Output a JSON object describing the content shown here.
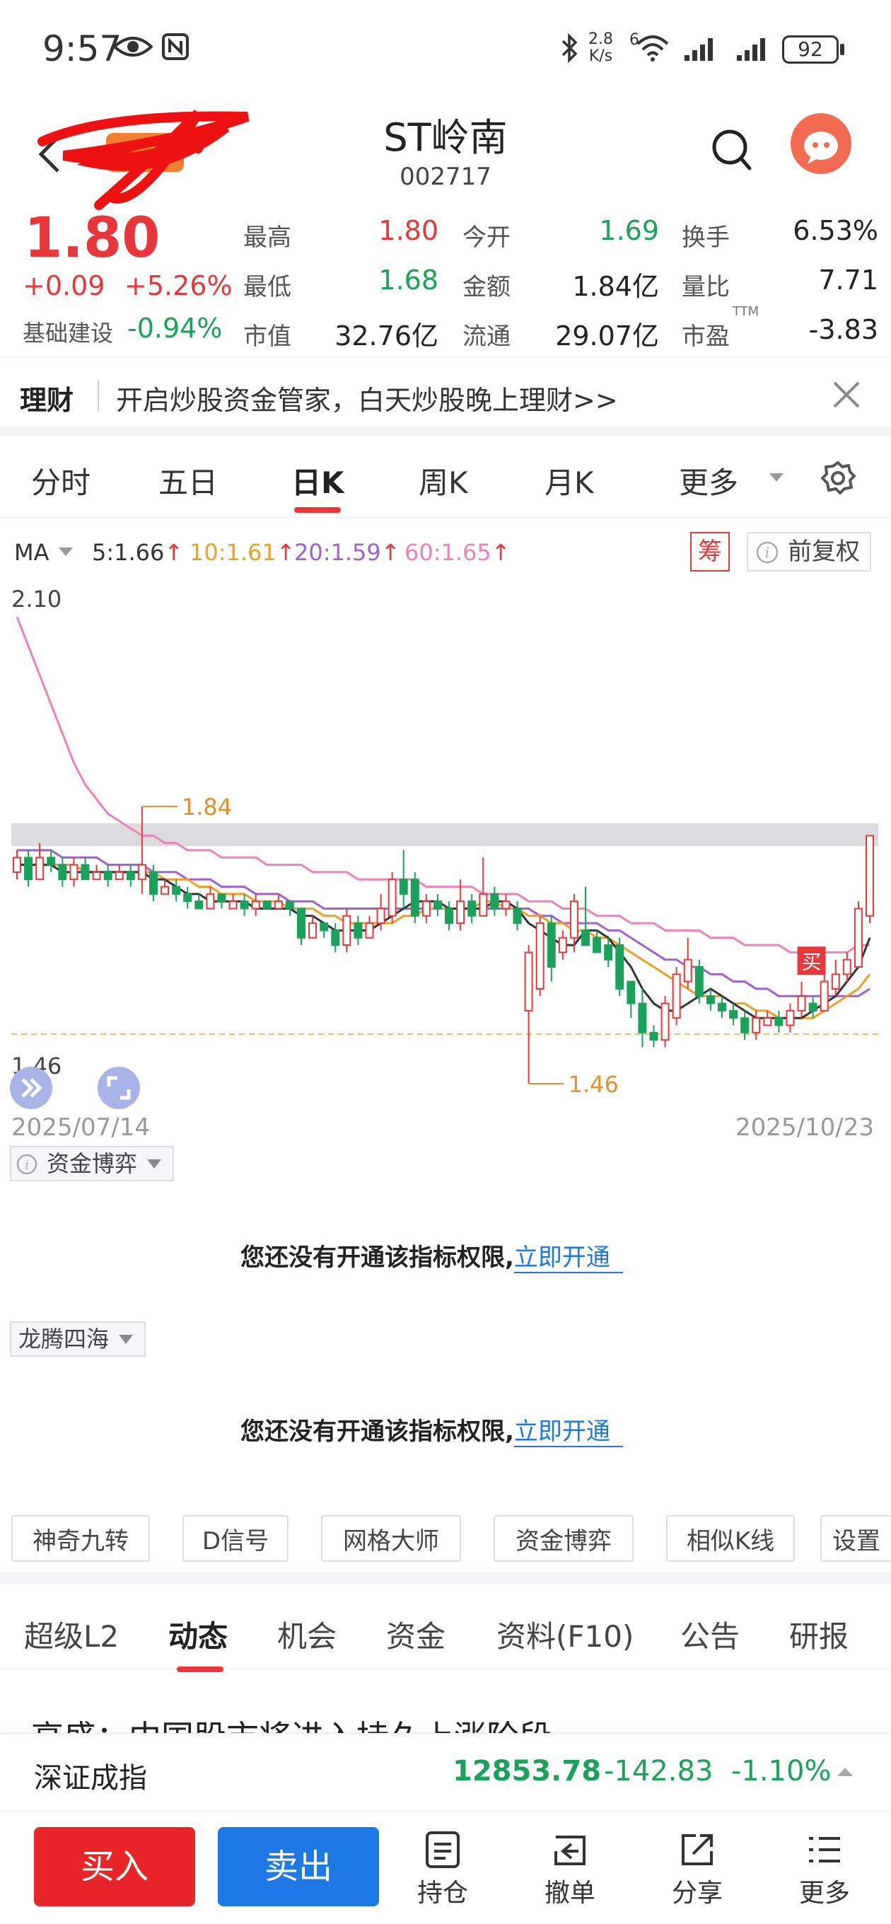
{
  "status": {
    "time": "9:57",
    "net_speed_top": "2.8",
    "net_speed_unit": "K/s",
    "net_type": "6",
    "battery": "92"
  },
  "header": {
    "stock_name": "ST岭南",
    "stock_code": "002717"
  },
  "quote": {
    "price": "1.80",
    "change": "+0.09",
    "change_pct": "+5.26%",
    "sector_name": "基础建设",
    "sector_pct": "-0.94%",
    "high_label": "最高",
    "high_value": "1.80",
    "low_label": "最低",
    "low_value": "1.68",
    "mcap_label": "市值",
    "mcap_value": "32.76亿",
    "open_label": "今开",
    "open_value": "1.69",
    "amount_label": "金额",
    "amount_value": "1.84亿",
    "float_label": "流通",
    "float_value": "29.07亿",
    "turnover_label": "换手",
    "turnover_value": "6.53%",
    "volratio_label": "量比",
    "volratio_value": "7.71",
    "pe_label": "市盈",
    "pe_sup": "TTM",
    "pe_value": "-3.83"
  },
  "promo": {
    "tag": "理财",
    "text": "开启炒股资金管家，白天炒股晚上理财>>"
  },
  "chart_tabs": {
    "items": [
      "分时",
      "五日",
      "日K",
      "周K",
      "月K"
    ],
    "more": "更多",
    "active_index": 2
  },
  "ma_legend": {
    "ma": "MA",
    "ma5": "5:1.66",
    "ma10": "10:1.61",
    "ma20": "20:1.59",
    "ma60": "60:1.65",
    "chip_btn": "筹",
    "adjust_btn": "前复权",
    "colors": {
      "ma5": "#333333",
      "ma10": "#f0a020",
      "ma20": "#a060d0",
      "ma60": "#f080b8"
    }
  },
  "chart_data": {
    "type": "candlestick",
    "y_top_label": "2.10",
    "y_bottom_label": "1.46",
    "ylim": [
      1.46,
      2.1
    ],
    "x_start": "2025/07/14",
    "x_end": "2025/10/23",
    "high_annotation": "1.84",
    "low_annotation": "1.46",
    "buy_marker": "买",
    "up_color": "#e8373a",
    "down_color": "#1aa25a",
    "candles": [
      {
        "o": 1.75,
        "c": 1.77,
        "h": 1.78,
        "l": 1.74
      },
      {
        "o": 1.77,
        "c": 1.74,
        "h": 1.78,
        "l": 1.73
      },
      {
        "o": 1.74,
        "c": 1.77,
        "h": 1.79,
        "l": 1.74
      },
      {
        "o": 1.77,
        "c": 1.76,
        "h": 1.78,
        "l": 1.75
      },
      {
        "o": 1.76,
        "c": 1.74,
        "h": 1.77,
        "l": 1.73
      },
      {
        "o": 1.74,
        "c": 1.76,
        "h": 1.77,
        "l": 1.73
      },
      {
        "o": 1.76,
        "c": 1.74,
        "h": 1.77,
        "l": 1.74
      },
      {
        "o": 1.74,
        "c": 1.75,
        "h": 1.76,
        "l": 1.74
      },
      {
        "o": 1.75,
        "c": 1.74,
        "h": 1.76,
        "l": 1.73
      },
      {
        "o": 1.74,
        "c": 1.75,
        "h": 1.76,
        "l": 1.74
      },
      {
        "o": 1.75,
        "c": 1.74,
        "h": 1.76,
        "l": 1.73
      },
      {
        "o": 1.74,
        "c": 1.76,
        "h": 1.84,
        "l": 1.72
      },
      {
        "o": 1.75,
        "c": 1.72,
        "h": 1.76,
        "l": 1.71
      },
      {
        "o": 1.72,
        "c": 1.73,
        "h": 1.74,
        "l": 1.72
      },
      {
        "o": 1.73,
        "c": 1.72,
        "h": 1.74,
        "l": 1.71
      },
      {
        "o": 1.72,
        "c": 1.71,
        "h": 1.73,
        "l": 1.7
      },
      {
        "o": 1.71,
        "c": 1.7,
        "h": 1.72,
        "l": 1.7
      },
      {
        "o": 1.7,
        "c": 1.72,
        "h": 1.73,
        "l": 1.7
      },
      {
        "o": 1.72,
        "c": 1.71,
        "h": 1.72,
        "l": 1.7
      },
      {
        "o": 1.7,
        "c": 1.71,
        "h": 1.72,
        "l": 1.7
      },
      {
        "o": 1.71,
        "c": 1.7,
        "h": 1.72,
        "l": 1.69
      },
      {
        "o": 1.7,
        "c": 1.71,
        "h": 1.72,
        "l": 1.69
      },
      {
        "o": 1.71,
        "c": 1.7,
        "h": 1.71,
        "l": 1.7
      },
      {
        "o": 1.7,
        "c": 1.71,
        "h": 1.72,
        "l": 1.7
      },
      {
        "o": 1.71,
        "c": 1.7,
        "h": 1.71,
        "l": 1.69
      },
      {
        "o": 1.7,
        "c": 1.66,
        "h": 1.7,
        "l": 1.65
      },
      {
        "o": 1.66,
        "c": 1.68,
        "h": 1.69,
        "l": 1.66
      },
      {
        "o": 1.68,
        "c": 1.67,
        "h": 1.68,
        "l": 1.66
      },
      {
        "o": 1.67,
        "c": 1.65,
        "h": 1.68,
        "l": 1.64
      },
      {
        "o": 1.65,
        "c": 1.69,
        "h": 1.7,
        "l": 1.64
      },
      {
        "o": 1.68,
        "c": 1.66,
        "h": 1.69,
        "l": 1.65
      },
      {
        "o": 1.66,
        "c": 1.68,
        "h": 1.69,
        "l": 1.66
      },
      {
        "o": 1.68,
        "c": 1.7,
        "h": 1.72,
        "l": 1.67
      },
      {
        "o": 1.69,
        "c": 1.74,
        "h": 1.75,
        "l": 1.68
      },
      {
        "o": 1.74,
        "c": 1.72,
        "h": 1.78,
        "l": 1.7
      },
      {
        "o": 1.74,
        "c": 1.69,
        "h": 1.75,
        "l": 1.68
      },
      {
        "o": 1.69,
        "c": 1.71,
        "h": 1.72,
        "l": 1.68
      },
      {
        "o": 1.71,
        "c": 1.7,
        "h": 1.72,
        "l": 1.69
      },
      {
        "o": 1.7,
        "c": 1.68,
        "h": 1.71,
        "l": 1.67
      },
      {
        "o": 1.68,
        "c": 1.71,
        "h": 1.74,
        "l": 1.67
      },
      {
        "o": 1.71,
        "c": 1.69,
        "h": 1.72,
        "l": 1.68
      },
      {
        "o": 1.69,
        "c": 1.72,
        "h": 1.77,
        "l": 1.69
      },
      {
        "o": 1.72,
        "c": 1.7,
        "h": 1.73,
        "l": 1.69
      },
      {
        "o": 1.7,
        "c": 1.71,
        "h": 1.72,
        "l": 1.69
      },
      {
        "o": 1.7,
        "c": 1.68,
        "h": 1.71,
        "l": 1.67
      },
      {
        "o": 1.56,
        "c": 1.64,
        "h": 1.65,
        "l": 1.46
      },
      {
        "o": 1.59,
        "c": 1.68,
        "h": 1.69,
        "l": 1.58
      },
      {
        "o": 1.68,
        "c": 1.62,
        "h": 1.69,
        "l": 1.6
      },
      {
        "o": 1.64,
        "c": 1.66,
        "h": 1.67,
        "l": 1.63
      },
      {
        "o": 1.66,
        "c": 1.71,
        "h": 1.72,
        "l": 1.64
      },
      {
        "o": 1.67,
        "c": 1.65,
        "h": 1.73,
        "l": 1.65
      },
      {
        "o": 1.66,
        "c": 1.64,
        "h": 1.67,
        "l": 1.64
      },
      {
        "o": 1.65,
        "c": 1.63,
        "h": 1.66,
        "l": 1.62
      },
      {
        "o": 1.65,
        "c": 1.59,
        "h": 1.66,
        "l": 1.58
      },
      {
        "o": 1.6,
        "c": 1.57,
        "h": 1.6,
        "l": 1.55
      },
      {
        "o": 1.57,
        "c": 1.53,
        "h": 1.59,
        "l": 1.51
      },
      {
        "o": 1.53,
        "c": 1.52,
        "h": 1.54,
        "l": 1.51
      },
      {
        "o": 1.52,
        "c": 1.57,
        "h": 1.58,
        "l": 1.51
      },
      {
        "o": 1.55,
        "c": 1.61,
        "h": 1.62,
        "l": 1.54
      },
      {
        "o": 1.6,
        "c": 1.63,
        "h": 1.66,
        "l": 1.59
      },
      {
        "o": 1.62,
        "c": 1.58,
        "h": 1.63,
        "l": 1.57
      },
      {
        "o": 1.58,
        "c": 1.57,
        "h": 1.59,
        "l": 1.56
      },
      {
        "o": 1.57,
        "c": 1.56,
        "h": 1.58,
        "l": 1.55
      },
      {
        "o": 1.56,
        "c": 1.55,
        "h": 1.57,
        "l": 1.54
      },
      {
        "o": 1.55,
        "c": 1.53,
        "h": 1.56,
        "l": 1.52
      },
      {
        "o": 1.53,
        "c": 1.55,
        "h": 1.56,
        "l": 1.52
      },
      {
        "o": 1.54,
        "c": 1.55,
        "h": 1.56,
        "l": 1.54
      },
      {
        "o": 1.55,
        "c": 1.54,
        "h": 1.56,
        "l": 1.53
      },
      {
        "o": 1.54,
        "c": 1.56,
        "h": 1.57,
        "l": 1.53
      },
      {
        "o": 1.56,
        "c": 1.58,
        "h": 1.6,
        "l": 1.55
      },
      {
        "o": 1.57,
        "c": 1.56,
        "h": 1.58,
        "l": 1.55
      },
      {
        "o": 1.56,
        "c": 1.6,
        "h": 1.61,
        "l": 1.56
      },
      {
        "o": 1.59,
        "c": 1.61,
        "h": 1.63,
        "l": 1.58
      },
      {
        "o": 1.61,
        "c": 1.63,
        "h": 1.64,
        "l": 1.6
      },
      {
        "o": 1.62,
        "c": 1.7,
        "h": 1.71,
        "l": 1.62
      },
      {
        "o": 1.69,
        "c": 1.8,
        "h": 1.8,
        "l": 1.68
      }
    ],
    "ma5": [
      1.76,
      1.76,
      1.76,
      1.76,
      1.75,
      1.75,
      1.75,
      1.75,
      1.75,
      1.75,
      1.75,
      1.75,
      1.74,
      1.74,
      1.73,
      1.72,
      1.72,
      1.71,
      1.71,
      1.71,
      1.71,
      1.7,
      1.7,
      1.7,
      1.7,
      1.69,
      1.69,
      1.68,
      1.67,
      1.67,
      1.67,
      1.67,
      1.68,
      1.69,
      1.7,
      1.71,
      1.71,
      1.71,
      1.7,
      1.7,
      1.7,
      1.7,
      1.71,
      1.71,
      1.7,
      1.68,
      1.67,
      1.66,
      1.65,
      1.65,
      1.67,
      1.67,
      1.66,
      1.64,
      1.62,
      1.59,
      1.57,
      1.56,
      1.56,
      1.57,
      1.58,
      1.59,
      1.58,
      1.57,
      1.56,
      1.55,
      1.55,
      1.55,
      1.55,
      1.55,
      1.56,
      1.57,
      1.58,
      1.6,
      1.62,
      1.66
    ],
    "ma10": [
      1.76,
      1.76,
      1.76,
      1.76,
      1.76,
      1.76,
      1.75,
      1.75,
      1.75,
      1.75,
      1.75,
      1.75,
      1.75,
      1.74,
      1.74,
      1.74,
      1.73,
      1.73,
      1.72,
      1.72,
      1.72,
      1.71,
      1.71,
      1.71,
      1.7,
      1.7,
      1.7,
      1.69,
      1.69,
      1.68,
      1.68,
      1.68,
      1.68,
      1.68,
      1.69,
      1.69,
      1.7,
      1.7,
      1.7,
      1.7,
      1.7,
      1.71,
      1.71,
      1.7,
      1.7,
      1.69,
      1.69,
      1.68,
      1.68,
      1.67,
      1.67,
      1.66,
      1.66,
      1.65,
      1.64,
      1.63,
      1.62,
      1.61,
      1.6,
      1.59,
      1.58,
      1.58,
      1.58,
      1.57,
      1.57,
      1.56,
      1.56,
      1.55,
      1.55,
      1.55,
      1.55,
      1.56,
      1.57,
      1.58,
      1.59,
      1.61
    ],
    "ma20": [
      1.78,
      1.78,
      1.78,
      1.78,
      1.77,
      1.77,
      1.77,
      1.77,
      1.76,
      1.76,
      1.76,
      1.76,
      1.75,
      1.75,
      1.75,
      1.74,
      1.74,
      1.74,
      1.73,
      1.73,
      1.73,
      1.72,
      1.72,
      1.72,
      1.71,
      1.71,
      1.71,
      1.7,
      1.7,
      1.7,
      1.7,
      1.7,
      1.7,
      1.7,
      1.7,
      1.7,
      1.7,
      1.7,
      1.7,
      1.7,
      1.7,
      1.7,
      1.7,
      1.7,
      1.7,
      1.7,
      1.69,
      1.69,
      1.68,
      1.68,
      1.68,
      1.68,
      1.67,
      1.67,
      1.66,
      1.65,
      1.64,
      1.63,
      1.63,
      1.62,
      1.62,
      1.61,
      1.61,
      1.6,
      1.6,
      1.59,
      1.59,
      1.58,
      1.58,
      1.58,
      1.58,
      1.58,
      1.58,
      1.58,
      1.58,
      1.59
    ],
    "ma60": [
      2.1,
      2.06,
      2.02,
      1.98,
      1.94,
      1.9,
      1.87,
      1.85,
      1.83,
      1.82,
      1.81,
      1.8,
      1.8,
      1.79,
      1.79,
      1.78,
      1.78,
      1.78,
      1.77,
      1.77,
      1.77,
      1.77,
      1.76,
      1.76,
      1.76,
      1.76,
      1.75,
      1.75,
      1.75,
      1.75,
      1.74,
      1.74,
      1.74,
      1.74,
      1.74,
      1.74,
      1.73,
      1.73,
      1.73,
      1.73,
      1.73,
      1.72,
      1.72,
      1.72,
      1.72,
      1.71,
      1.71,
      1.71,
      1.7,
      1.7,
      1.7,
      1.69,
      1.69,
      1.69,
      1.68,
      1.68,
      1.68,
      1.67,
      1.67,
      1.67,
      1.67,
      1.66,
      1.66,
      1.66,
      1.65,
      1.65,
      1.65,
      1.65,
      1.64,
      1.64,
      1.64,
      1.64,
      1.64,
      1.64,
      1.65,
      1.65
    ]
  },
  "chart_controls": {
    "expand_icon": "double-chevron-right-icon",
    "fullscreen_icon": "fullscreen-icon"
  },
  "indicators": [
    {
      "name": "资金博弈",
      "locked_text": "您还没有开通该指标权限,",
      "link_text": "立即开通"
    },
    {
      "name": "龙腾四海",
      "locked_text": "您还没有开通该指标权限,",
      "link_text": "立即开通"
    }
  ],
  "tool_buttons": [
    "神奇九转",
    "D信号",
    "网格大师",
    "资金博弈",
    "相似K线",
    "设置"
  ],
  "sub_tabs": {
    "items": [
      "超级L2",
      "动态",
      "机会",
      "资金",
      "资料(F10)",
      "公告",
      "研报"
    ],
    "active_index": 1
  },
  "news": {
    "headline": "高盛：中国股市将进入持久上涨阶段"
  },
  "index_bar": {
    "name": "深证成指",
    "value": "12853.78",
    "change": "-142.83",
    "change_pct": "-1.10%"
  },
  "bottom_nav": {
    "buy": "买入",
    "sell": "卖出",
    "items": [
      "持仓",
      "撤单",
      "分享",
      "更多"
    ]
  }
}
